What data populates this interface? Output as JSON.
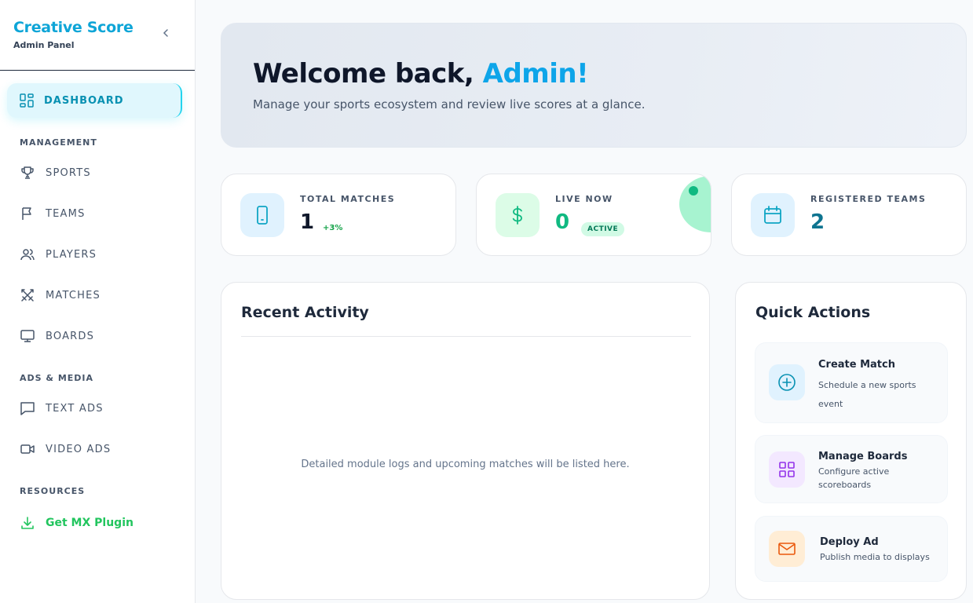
{
  "brand": {
    "title": "Creative Score",
    "subtitle": "Admin Panel"
  },
  "nav": {
    "dashboard": "DASHBOARD",
    "section_management": "MANAGEMENT",
    "sports": "SPORTS",
    "teams": "TEAMS",
    "players": "PLAYERS",
    "matches": "MATCHES",
    "boards": "BOARDS",
    "section_ads": "ADS & MEDIA",
    "text_ads": "TEXT ADS",
    "video_ads": "VIDEO ADS",
    "section_resources": "RESOURCES",
    "plugin": "Get MX Plugin"
  },
  "hero": {
    "greeting": "Welcome back, ",
    "name": "Admin!",
    "subtitle": "Manage your sports ecosystem and review live scores at a glance."
  },
  "stats": {
    "total": {
      "label": "TOTAL MATCHES",
      "value": "1",
      "trend": "+3%"
    },
    "live": {
      "label": "LIVE NOW",
      "value": "0",
      "badge": "ACTIVE"
    },
    "teams": {
      "label": "REGISTERED TEAMS",
      "value": "2"
    }
  },
  "recent": {
    "title": "Recent Activity",
    "empty": "Detailed module logs and upcoming matches will be listed here."
  },
  "quick": {
    "title": "Quick Actions",
    "create": {
      "title": "Create Match",
      "desc": "Schedule a new sports event"
    },
    "boards": {
      "title": "Manage Boards",
      "desc": "Configure active scoreboards"
    },
    "deploy": {
      "title": "Deploy Ad",
      "desc": "Publish media to displays"
    }
  },
  "colors": {
    "accent": "#0ea5e9",
    "active_nav_bg": "#e0f7fd",
    "plugin_green": "#22c55e",
    "live_green": "#10b981"
  },
  "icons": {
    "dashboard": "grid-icon",
    "sports": "trophy-icon",
    "teams": "flag-icon",
    "players": "users-icon",
    "matches": "swords-icon",
    "boards": "monitor-icon",
    "text_ads": "message-icon",
    "video_ads": "video-icon",
    "plugin": "download-icon"
  }
}
